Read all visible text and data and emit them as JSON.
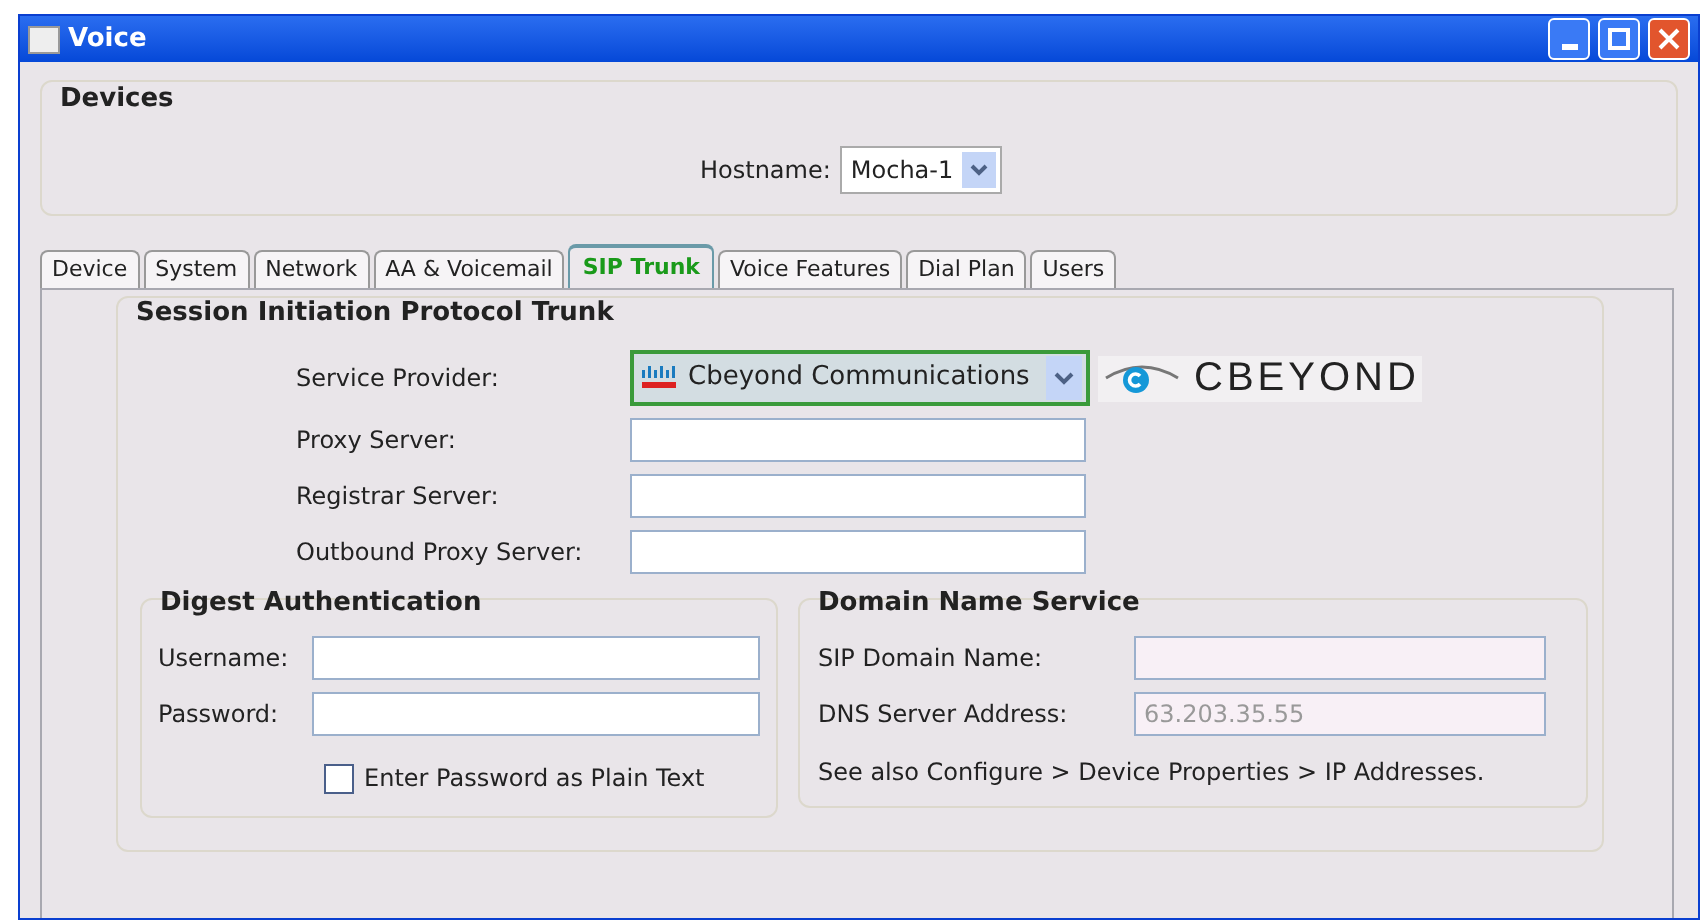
{
  "window": {
    "title": "Voice"
  },
  "devices": {
    "title": "Devices",
    "hostname_label": "Hostname:",
    "hostname_value": "Mocha-1"
  },
  "tabs": [
    {
      "label": "Device",
      "selected": false
    },
    {
      "label": "System",
      "selected": false
    },
    {
      "label": "Network",
      "selected": false
    },
    {
      "label": "AA & Voicemail",
      "selected": false
    },
    {
      "label": "SIP Trunk",
      "selected": true
    },
    {
      "label": "Voice Features",
      "selected": false
    },
    {
      "label": "Dial Plan",
      "selected": false
    },
    {
      "label": "Users",
      "selected": false
    }
  ],
  "sip_trunk": {
    "title": "Session Initiation Protocol Trunk",
    "service_provider": {
      "label": "Service Provider:",
      "value": "Cbeyond Communications",
      "logo_text": "CBEYOND"
    },
    "fields": [
      {
        "label": "Proxy Server:"
      },
      {
        "label": "Registrar Server:"
      },
      {
        "label": "Outbound Proxy Server:"
      }
    ]
  },
  "digest": {
    "title": "Digest Authentication",
    "fields": [
      {
        "label": "Username:"
      },
      {
        "label": "Password:"
      }
    ],
    "plain_text": {
      "label": "Enter Password as Plain Text",
      "checked": false
    }
  },
  "dns": {
    "title": "Domain Name Service",
    "fields": [
      {
        "label": "SIP Domain Name:"
      },
      {
        "label": "DNS Server Address:",
        "value": "63.203.35.55"
      }
    ],
    "note": "See also Configure > Device Properties > IP Addresses."
  }
}
